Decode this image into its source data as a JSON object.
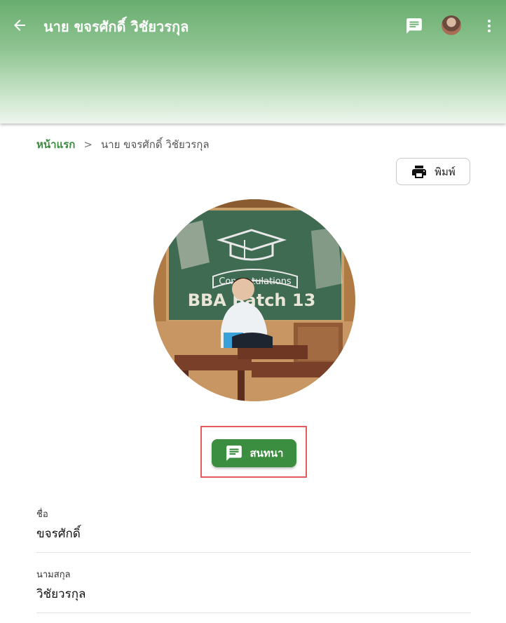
{
  "header": {
    "title": "นาย ขจรศักดิ์ วิชัยวรกุล",
    "icons": {
      "back": "arrow-left-icon",
      "chat": "chat-icon",
      "more": "more-vert-icon"
    }
  },
  "breadcrumb": {
    "home": "หน้าแรก",
    "separator": ">",
    "current": "นาย ขจรศักดิ์ วิชัยวรกุล"
  },
  "actions": {
    "print_label": "พิมพ์",
    "chat_label": "สนทนา"
  },
  "profile": {
    "photo_text": {
      "congrats": "Congratulations",
      "batch": "BBA Batch 13"
    },
    "fields": [
      {
        "label": "ชื่อ",
        "value": "ขจรศักดิ์"
      },
      {
        "label": "นามสกุล",
        "value": "วิชัยวรกุล"
      }
    ]
  },
  "colors": {
    "primary": "#3b8e3f",
    "highlight": "#e65c5c",
    "header_top": "#69ad6f"
  }
}
